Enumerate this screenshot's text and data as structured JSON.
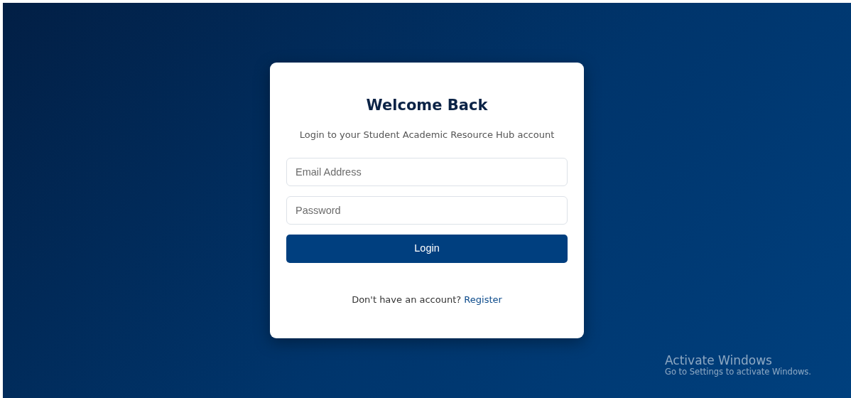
{
  "login_card": {
    "title": "Welcome Back",
    "subtitle": "Login to your Student Academic Resource Hub account",
    "fields": [
      {
        "placeholder": "Email Address"
      },
      {
        "placeholder": "Password"
      }
    ],
    "button": "Login",
    "prompt": "Don't have an account?",
    "link": "Register"
  },
  "activation_notice": {
    "title": "Activate Windows",
    "message": "Go to Settings to activate Windows."
  }
}
